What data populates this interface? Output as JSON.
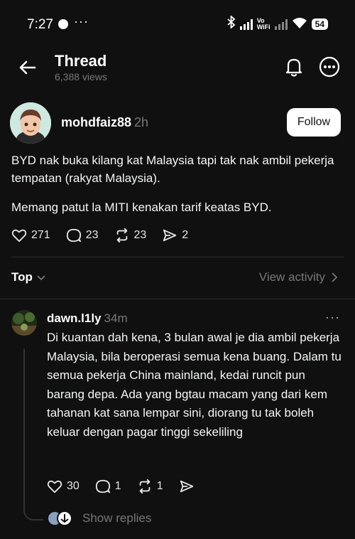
{
  "status_bar": {
    "time": "7:27",
    "more": "···",
    "volte_1": "Vo",
    "volte_2": "WiFi",
    "battery": "54"
  },
  "header": {
    "title": "Thread",
    "views": "6,388 views"
  },
  "post": {
    "username": "mohdfaiz88",
    "time": "2h",
    "follow_label": "Follow",
    "paragraphs": [
      "BYD nak buka kilang kat Malaysia tapi tak nak ambil pekerja tempatan (rakyat Malaysia).",
      "Memang patut la MITI kenakan tarif keatas BYD."
    ],
    "likes": "271",
    "comments": "23",
    "reposts": "23",
    "shares": "2"
  },
  "sort": {
    "label": "Top",
    "view_activity": "View activity"
  },
  "reply": {
    "username": "dawn.l1ly",
    "time": "34m",
    "more": "···",
    "text": "Di kuantan dah kena, 3 bulan awal je dia ambil pekerja Malaysia, bila beroperasi semua kena buang. Dalam tu semua pekerja China mainland, kedai runcit pun barang depa. Ada yang bgtau macam yang dari kem tahanan kat sana lempar sini, diorang tu tak boleh keluar dengan pagar tinggi sekeliling",
    "likes": "30",
    "comments": "1",
    "reposts": "1",
    "show_replies": "Show replies"
  },
  "colors": {
    "background": "#101010",
    "text": "#f3f5f7",
    "muted": "#777777",
    "divider": "#2a2a2a",
    "button_bg": "#ffffff"
  },
  "icons": [
    "back-arrow-icon",
    "bell-icon",
    "more-menu-icon",
    "heart-icon",
    "comment-icon",
    "repost-icon",
    "share-icon",
    "chevron-down-icon",
    "chevron-right-icon"
  ]
}
